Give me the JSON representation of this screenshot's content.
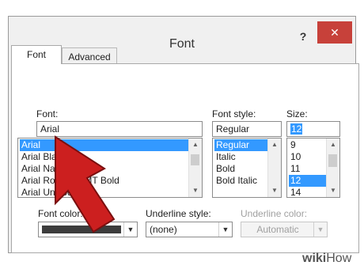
{
  "window": {
    "title": "Font",
    "help_label": "?",
    "close_label": "✕"
  },
  "tabs": [
    {
      "label": "Font"
    },
    {
      "label": "Advanced"
    }
  ],
  "font": {
    "label": "Font:",
    "value": "Arial",
    "items": [
      "Arial",
      "Arial Black",
      "Arial Narrow",
      "Arial Rounded MT Bold",
      "Arial Unicode MS"
    ],
    "selected": 0
  },
  "font_style": {
    "label": "Font style:",
    "value": "Regular",
    "items": [
      "Regular",
      "Italic",
      "Bold",
      "Bold Italic"
    ],
    "selected": 0
  },
  "size": {
    "label": "Size:",
    "value": "12",
    "items": [
      "9",
      "10",
      "11",
      "12",
      "14"
    ],
    "selected": 3
  },
  "font_color": {
    "label": "Font color:",
    "swatch": "#3c3c3c"
  },
  "underline_style": {
    "label": "Underline style:",
    "value": "(none)"
  },
  "underline_color": {
    "label": "Underline color:",
    "value": "Automatic"
  },
  "watermark": {
    "wiki": "wiki",
    "how": "How"
  },
  "colors": {
    "selection": "#3399ff",
    "arrow": "#cc1f1f",
    "close": "#c7413a"
  }
}
